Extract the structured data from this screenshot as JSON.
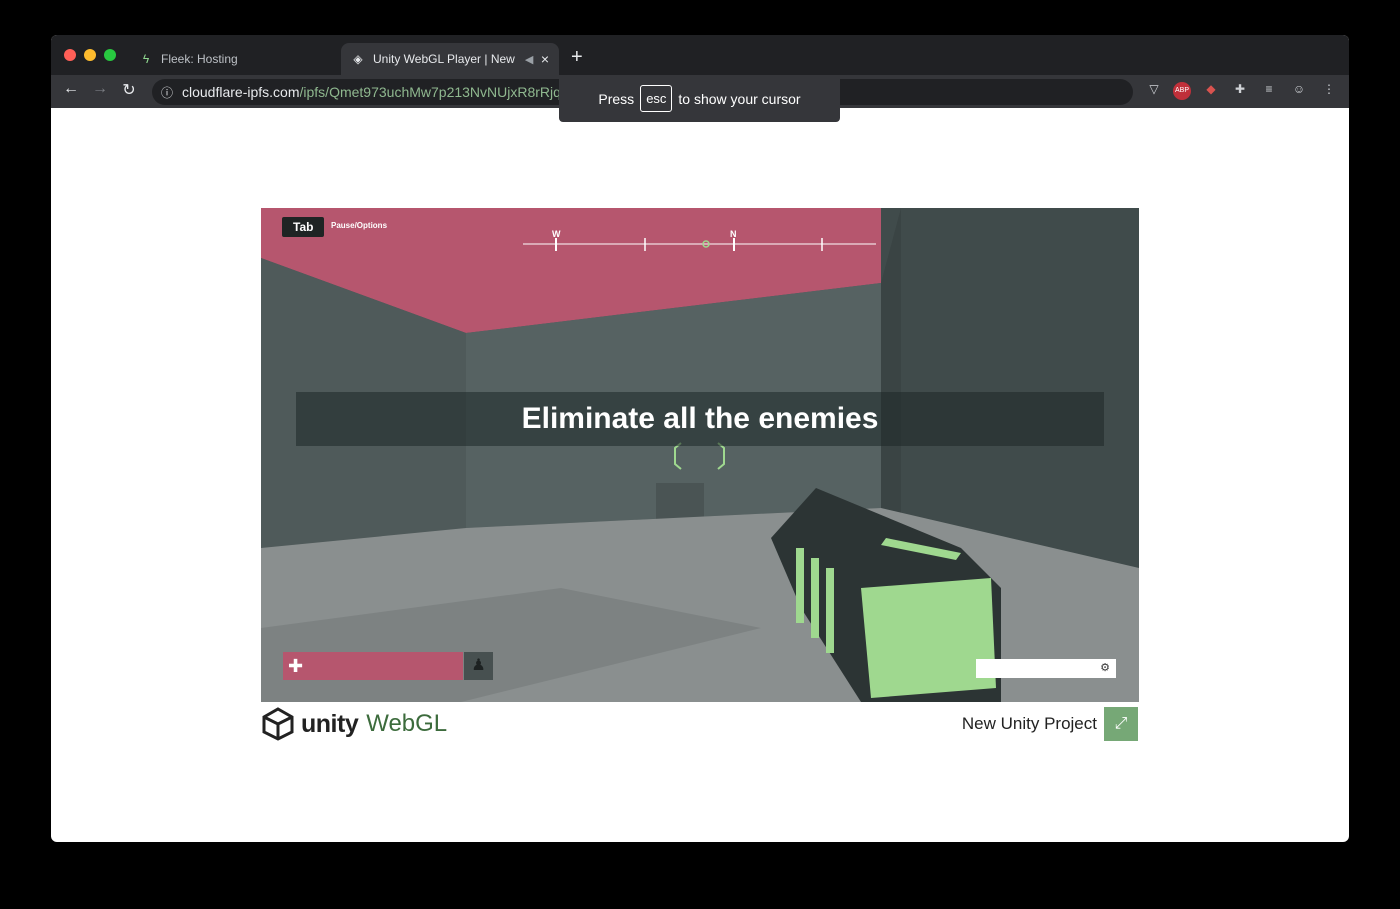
{
  "browser": {
    "tabs": [
      {
        "label": "Fleek: Hosting",
        "icon": "lightning-icon"
      },
      {
        "label": "Unity WebGL Player | New",
        "icon": "unity-icon"
      }
    ],
    "new_tab": "+",
    "close": "×",
    "url_host": "cloudflare-ipfs.com",
    "url_path": "/ipfs/Qmet973uchMw7p213NvNUjxR8rRjqhh",
    "extensions": [
      "pocket-icon",
      "adblock-icon",
      "fox-icon",
      "puzzle-icon",
      "reading-list-icon",
      "profile-icon",
      "menu-icon"
    ],
    "adblock_text": "ABP"
  },
  "esc_banner": {
    "press": "Press",
    "key": "esc",
    "rest": "to show your cursor"
  },
  "game": {
    "tab_key": "Tab",
    "pause_label": "Pause/Options",
    "compass": {
      "w": "W",
      "n": "N"
    },
    "objective": "Eliminate all the enemies",
    "health_fraction": 1.0,
    "colors": {
      "ceiling": "#b6566e",
      "wall": "#4b5656",
      "floor": "#8a8f8f",
      "weapon_glow": "#9fd88f"
    }
  },
  "footer": {
    "unity": "unity",
    "webgl": "WebGL",
    "project_title": "New Unity Project"
  }
}
